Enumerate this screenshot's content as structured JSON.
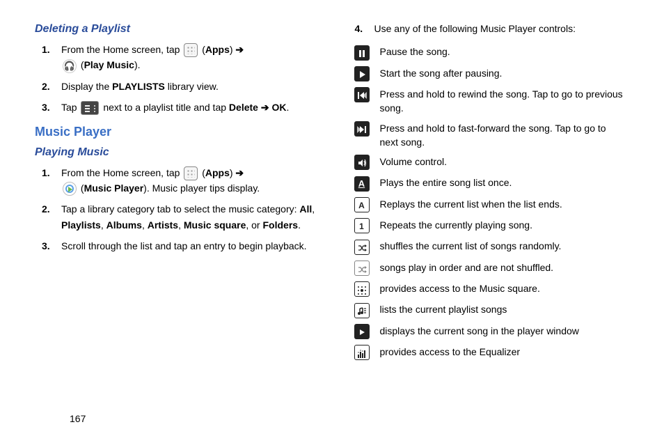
{
  "page_number": "167",
  "left": {
    "sub1": "Deleting a Playlist",
    "del1_a": "From the Home screen, tap",
    "del1_b": "(",
    "del1_bold1": "Apps",
    "del1_c": ") ",
    "del1_arrow": "➔",
    "del1_d": " (",
    "del1_bold2": "Play Music",
    "del1_e": ").",
    "del2_a": "Display the ",
    "del2_bold": "PLAYLISTS",
    "del2_b": " library view.",
    "del3_a": "Tap ",
    "del3_b": " next to a playlist title and tap ",
    "del3_bold1": "Delete",
    "del3_arrow": "➔",
    "del3_bold2": "OK",
    "del3_c": ".",
    "heading": "Music Player",
    "sub2": "Playing Music",
    "pm1_a": "From the Home screen, tap",
    "pm1_b": "(",
    "pm1_bold1": "Apps",
    "pm1_c": ") ",
    "pm1_arrow": "➔",
    "pm1_d": " (",
    "pm1_bold2": "Music Player",
    "pm1_e": "). Music player tips display.",
    "pm2_a": "Tap a library category tab to select the music category: ",
    "pm2_b1": "All",
    "pm2_c1": ", ",
    "pm2_b2": "Playlists",
    "pm2_c2": ", ",
    "pm2_b3": "Albums",
    "pm2_c3": ", ",
    "pm2_b4": "Artists",
    "pm2_c4": ", ",
    "pm2_b5": "Music square",
    "pm2_c5": ", or ",
    "pm2_b6": "Folders",
    "pm2_c6": ".",
    "pm3": "Scroll through the list and tap an entry to begin playback."
  },
  "right": {
    "step4": "Use any of the following Music Player controls:",
    "controls": [
      "Pause the song.",
      "Start the song after pausing.",
      "Press and hold to rewind the song. Tap to go to previous song.",
      "Press and hold to fast-forward the song. Tap to go to next song.",
      "Volume control.",
      "Plays the entire song list once.",
      "Replays the current list when the list ends.",
      "Repeats the currently playing song.",
      "shuffles the current list of songs randomly.",
      "songs play in order and are not shuffled.",
      "provides access to the Music square.",
      "lists the current playlist songs",
      "displays the current song in the player window",
      "provides access to the Equalizer"
    ]
  }
}
